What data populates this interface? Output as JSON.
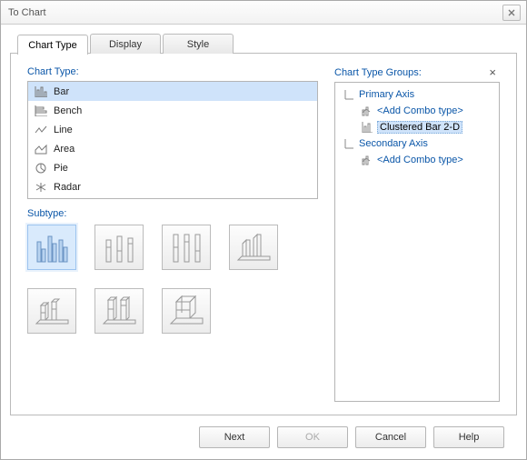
{
  "window": {
    "title": "To Chart"
  },
  "tabs": [
    {
      "label": "Chart Type",
      "active": true
    },
    {
      "label": "Display",
      "active": false
    },
    {
      "label": "Style",
      "active": false
    }
  ],
  "chart_type": {
    "label": "Chart Type:",
    "items": [
      {
        "label": "Bar",
        "selected": true,
        "icon": "bar-icon"
      },
      {
        "label": "Bench",
        "selected": false,
        "icon": "bench-icon"
      },
      {
        "label": "Line",
        "selected": false,
        "icon": "line-icon"
      },
      {
        "label": "Area",
        "selected": false,
        "icon": "area-icon"
      },
      {
        "label": "Pie",
        "selected": false,
        "icon": "pie-icon"
      },
      {
        "label": "Radar",
        "selected": false,
        "icon": "radar-icon"
      }
    ]
  },
  "subtype": {
    "label": "Subtype:"
  },
  "groups": {
    "label": "Chart Type Groups:",
    "close_glyph": "×",
    "tree": {
      "primary": {
        "label": "Primary Axis"
      },
      "primary_add": {
        "label": "<Add Combo type>"
      },
      "primary_item": {
        "label": "Clustered Bar 2-D"
      },
      "secondary": {
        "label": "Secondary Axis"
      },
      "secondary_add": {
        "label": "<Add Combo type>"
      }
    }
  },
  "buttons": {
    "next": "Next",
    "ok": "OK",
    "cancel": "Cancel",
    "help": "Help"
  }
}
